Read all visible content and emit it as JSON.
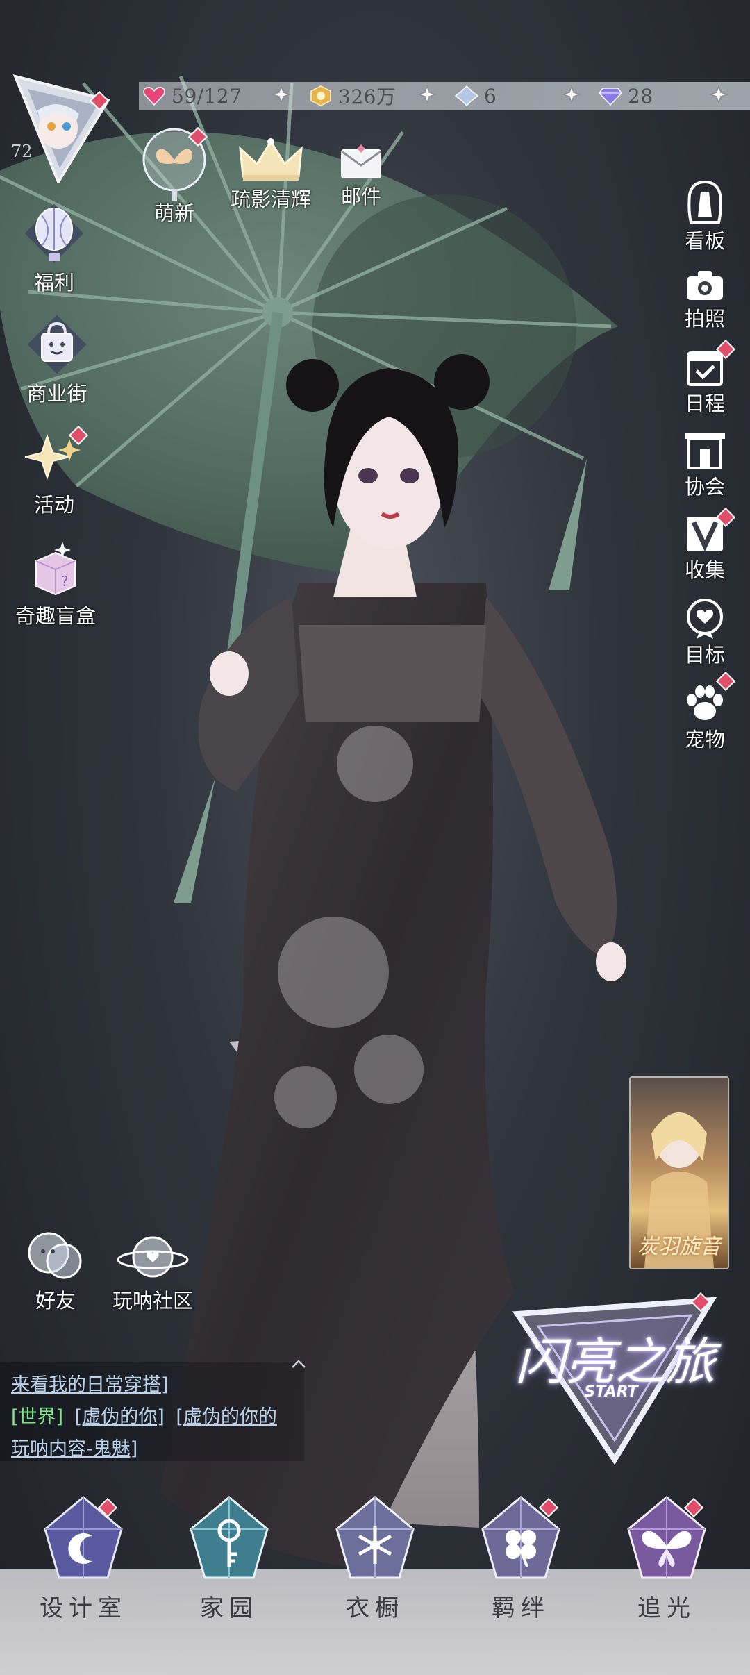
{
  "player": {
    "level": "72"
  },
  "resources": [
    {
      "name": "stamina",
      "icon": "heart-gem-icon",
      "value": "59/127",
      "color": "#e8457a"
    },
    {
      "name": "gold",
      "icon": "gold-coin-icon",
      "value": "326万",
      "color": "#e8b44a"
    },
    {
      "name": "crystal",
      "icon": "crystal-icon",
      "value": "6",
      "color": "#b4c8e6"
    },
    {
      "name": "diamond",
      "icon": "diamond-icon",
      "value": "28",
      "color": "#8a7be6"
    }
  ],
  "top_icons": [
    {
      "label": "萌新",
      "icon": "butterfly-lantern-icon"
    },
    {
      "label": "疏影清辉",
      "icon": "crown-icon"
    },
    {
      "label": "邮件",
      "icon": "mail-icon"
    }
  ],
  "left_menu": [
    {
      "label": "福利",
      "icon": "hot-air-balloon-icon"
    },
    {
      "label": "商业街",
      "icon": "shopping-bag-icon"
    },
    {
      "label": "活动",
      "icon": "sparkle-star-icon"
    },
    {
      "label": "奇趣盲盒",
      "icon": "mystery-box-icon"
    }
  ],
  "right_menu": [
    {
      "label": "看板",
      "icon": "dress-icon"
    },
    {
      "label": "拍照",
      "icon": "camera-icon"
    },
    {
      "label": "日程",
      "icon": "calendar-icon"
    },
    {
      "label": "协会",
      "icon": "guild-building-icon"
    },
    {
      "label": "收集",
      "icon": "collection-v-icon"
    },
    {
      "label": "目标",
      "icon": "target-medal-icon"
    },
    {
      "label": "宠物",
      "icon": "paw-icon"
    }
  ],
  "social": [
    {
      "label": "好友",
      "icon": "friends-bubble-icon"
    },
    {
      "label": "玩呐社区",
      "icon": "community-planet-icon"
    }
  ],
  "chat": {
    "line1": "来看我的日常穿搭]",
    "channel": "[世界]",
    "user1": "[虚伪的你]",
    "user2": "[虚伪的你的",
    "line3": "玩呐内容-鬼魅]"
  },
  "banner": {
    "text": "炭羽旋音"
  },
  "start_button": {
    "title": "闪亮之旅",
    "subtitle": "START"
  },
  "bottom_nav": [
    {
      "label": "设计室",
      "icon": "crescent-gem-icon"
    },
    {
      "label": "家园",
      "icon": "key-gem-icon"
    },
    {
      "label": "衣橱",
      "icon": "snowflake-gem-icon"
    },
    {
      "label": "羁绊",
      "icon": "clover-gem-icon"
    },
    {
      "label": "追光",
      "icon": "butterfly-gem-icon"
    }
  ],
  "colors": {
    "badge_red": "#e04e6a",
    "umbrella_green": "#5f7a6e",
    "dress_dark": "#3a3538",
    "nav_bar": "#cfcfd3"
  }
}
